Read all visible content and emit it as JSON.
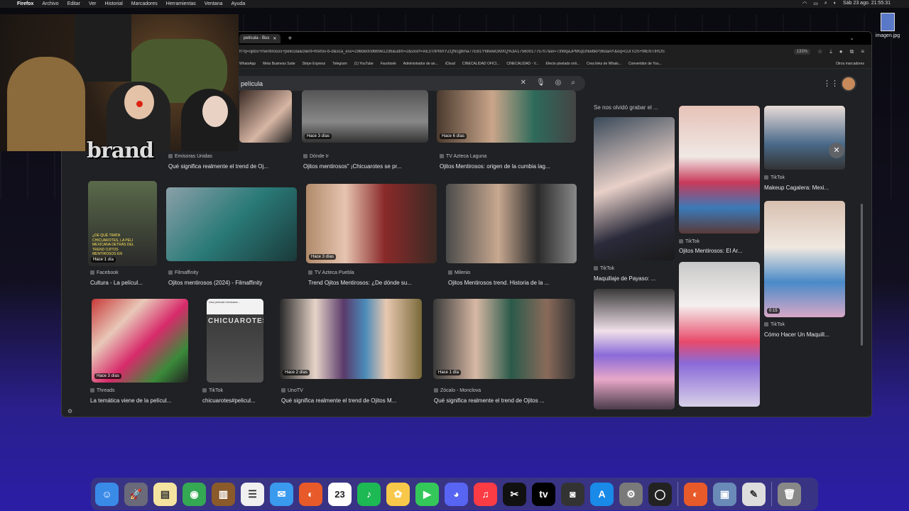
{
  "menubar": {
    "app": "Firefox",
    "items": [
      "Archivo",
      "Editar",
      "Ver",
      "Historial",
      "Marcadores",
      "Herramientas",
      "Ventana",
      "Ayuda"
    ],
    "clock": "Sáb 23 ago.  21:55:31"
  },
  "desktop": {
    "file_label": "imagen.jpg"
  },
  "browser": {
    "tab_title": "película - Bus",
    "url": "h?q=ojitos+mentirosos+pelicula&client=firefox-b-d&sca_esv=298de00d669e1236&udm=2&sxsrf=AE3TifPl8XYZQNcgbma77EB1Y6llwwGMXQ%3A1756001775707&ei=73WqaJP6KqGNwbkP36oaAY&oq=OJITOS+MENTIROS",
    "zoom": "133%",
    "bookmarks": [
      "WhatsApp",
      "Meta Business Suite",
      "Stripe Express",
      "Telegram",
      "(1) YouTube",
      "Facebook",
      "Administrador de an...",
      "iCloud",
      "CINECALIDAD OFICI...",
      "CINECALIDAD - V...",
      "Efecto pixelado onli...",
      "Crea links de Whats...",
      "Convertidor de You..."
    ],
    "bookmarks_other": "Otros marcadores",
    "search_query": "película"
  },
  "results": [
    {
      "source": "Emisoras Unidas",
      "title": "Qué significa realmente el trend de Oj...",
      "badge": ""
    },
    {
      "source": "Dónde Ir",
      "title": "Ojitos mentirosos\" ¡Chicuarotes se pr...",
      "badge": "Hace 3 días"
    },
    {
      "source": "TV Azteca Laguna",
      "title": "Ojitos Mentirosos: origen de la cumbia lag...",
      "badge": "Hace 6 días"
    },
    {
      "source": "Facebook",
      "title": "Cultura - La películ...",
      "badge": "Hace 1 día"
    },
    {
      "source": "Filmaffinity",
      "title": "Ojitos mentirosos (2024) - Filmaffinity",
      "badge": ""
    },
    {
      "source": "TV Azteca Puebla",
      "title": "Trend Ojitos Mentirosos: ¿De dónde su...",
      "badge": "Hace 3 días"
    },
    {
      "source": "Milenio",
      "title": "Ojitos Mentirosos trend. Historia de la ...",
      "badge": ""
    },
    {
      "source": "Threads",
      "title": "La temática viene de la películ...",
      "badge": "Hace 3 días"
    },
    {
      "source": "TikTok",
      "title": "chicuarotes#pelicul...",
      "badge": ""
    },
    {
      "source": "UnoTV",
      "title": "Qué significa realmente el trend de Ojitos M...",
      "badge": "Hace 2 días"
    },
    {
      "source": "Zócalo - Monclova",
      "title": "Qué significa realmente el trend de Ojitos ...",
      "badge": "Hace 1 día"
    }
  ],
  "facebook_thumb_text": "¿DE QUÉ TRATA CHICUAROTES, LA PELI MEXICANA DETRÁS DEL TREND OJITOS MENTIROSOS EN TIKTOK?",
  "chicuarotes_poster": "CHICUAROTES",
  "chicuarotes_note": "Una película mexicana...",
  "side": {
    "top_text": "Se nos olvidó grabar el ...",
    "items": [
      {
        "source": "TikTok",
        "title": "Maquillaje de Payaso: ..."
      },
      {
        "source": "TikTok",
        "title": "Ojitos Mentirosos: El Ar..."
      },
      {
        "source": "TikTok",
        "title": "Makeup Cagalera: Mexi..."
      },
      {
        "source": "TikTok",
        "title": "Cómo Hacer Un Maquill..."
      }
    ],
    "video_time": "0:15"
  },
  "overlay": {
    "logo_text": "brand"
  },
  "dock": [
    "Finder",
    "Launchpad",
    "Notes",
    "Chrome",
    "Notebook",
    "Reminders",
    "Messages",
    "Firefox",
    "Calendar",
    "Spotify",
    "Photos",
    "FaceTime",
    "Discord",
    "Music",
    "CapCut",
    "Apple TV",
    "Camera",
    "App Store",
    "System Settings",
    "OBS",
    "Firefox",
    "Preview",
    "Tool",
    "Trash"
  ],
  "calendar_day": "23",
  "colors": {
    "accent": "#8ab4f8",
    "panel": "#202124",
    "search": "#303134"
  }
}
